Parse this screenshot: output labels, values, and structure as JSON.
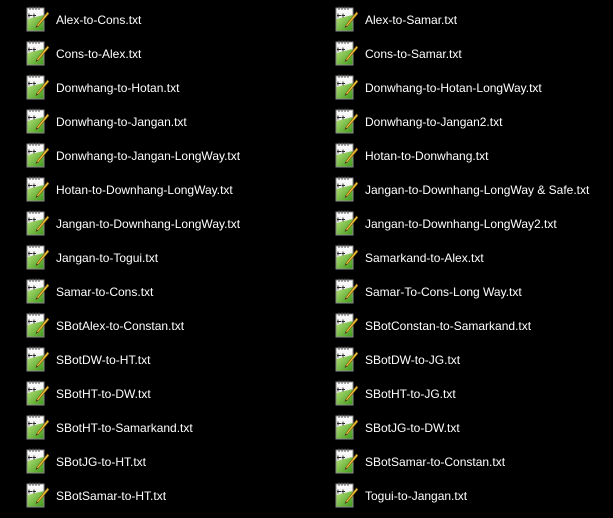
{
  "icon": "notepad-plus-plus-text-file-icon",
  "columns": [
    {
      "files": [
        {
          "name": "Alex-to-Cons.txt"
        },
        {
          "name": "Cons-to-Alex.txt"
        },
        {
          "name": "Donwhang-to-Hotan.txt"
        },
        {
          "name": "Donwhang-to-Jangan.txt"
        },
        {
          "name": "Donwhang-to-Jangan-LongWay.txt"
        },
        {
          "name": "Hotan-to-Downhang-LongWay.txt"
        },
        {
          "name": "Jangan-to-Downhang-LongWay.txt"
        },
        {
          "name": "Jangan-to-Togui.txt"
        },
        {
          "name": "Samar-to-Cons.txt"
        },
        {
          "name": "SBotAlex-to-Constan.txt"
        },
        {
          "name": "SBotDW-to-HT.txt"
        },
        {
          "name": "SBotHT-to-DW.txt"
        },
        {
          "name": "SBotHT-to-Samarkand.txt"
        },
        {
          "name": "SBotJG-to-HT.txt"
        },
        {
          "name": "SBotSamar-to-HT.txt"
        }
      ]
    },
    {
      "files": [
        {
          "name": "Alex-to-Samar.txt"
        },
        {
          "name": "Cons-to-Samar.txt"
        },
        {
          "name": "Donwhang-to-Hotan-LongWay.txt"
        },
        {
          "name": "Donwhang-to-Jangan2.txt"
        },
        {
          "name": "Hotan-to-Donwhang.txt"
        },
        {
          "name": "Jangan-to-Downhang-LongWay & Safe.txt"
        },
        {
          "name": "Jangan-to-Downhang-LongWay2.txt"
        },
        {
          "name": "Samarkand-to-Alex.txt"
        },
        {
          "name": "Samar-To-Cons-Long Way.txt"
        },
        {
          "name": "SBotConstan-to-Samarkand.txt"
        },
        {
          "name": "SBotDW-to-JG.txt"
        },
        {
          "name": "SBotHT-to-JG.txt"
        },
        {
          "name": "SBotJG-to-DW.txt"
        },
        {
          "name": "SBotSamar-to-Constan.txt"
        },
        {
          "name": "Togui-to-Jangan.txt"
        }
      ]
    }
  ]
}
